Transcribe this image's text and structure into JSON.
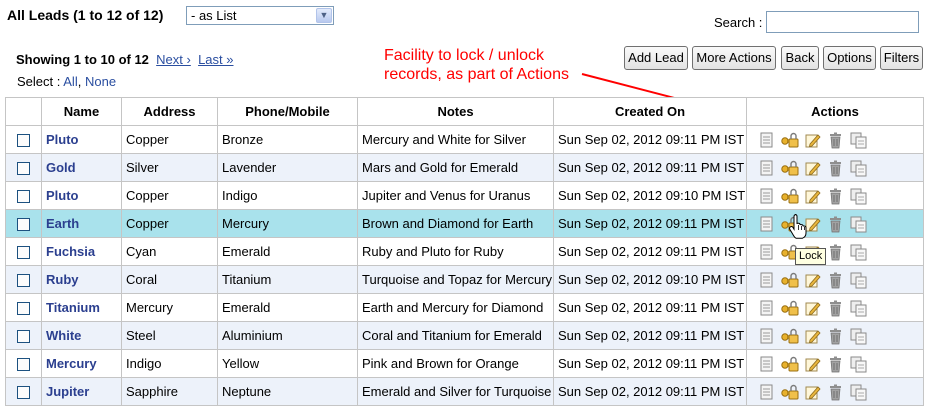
{
  "header": {
    "title": "All Leads (1 to 12 of 12)",
    "view_select": "- as List",
    "search_label": "Search :",
    "search_value": ""
  },
  "pager": {
    "showing": "Showing 1 to 10 of 12",
    "next": "Next ›",
    "last": "Last »",
    "select_label": "Select :",
    "select_all": "All",
    "select_sep": ",",
    "select_none": "None"
  },
  "toolbar": {
    "add_lead": "Add Lead",
    "more_actions": "More Actions",
    "back": "Back",
    "options": "Options",
    "filters": "Filters"
  },
  "annotation": {
    "line1": "Facility to lock / unlock",
    "line2": "records, as part of Actions",
    "color": "#ff0000"
  },
  "table": {
    "columns": [
      "Name",
      "Address",
      "Phone/Mobile",
      "Notes",
      "Created On",
      "Actions"
    ],
    "rows": [
      {
        "name": "Pluto",
        "address": "Copper",
        "phone": "Bronze",
        "notes": "Mercury and White for Silver",
        "created": "Sun Sep 02, 2012 09:11 PM IST"
      },
      {
        "name": "Gold",
        "address": "Silver",
        "phone": "Lavender",
        "notes": "Mars and Gold for Emerald",
        "created": "Sun Sep 02, 2012 09:11 PM IST"
      },
      {
        "name": "Pluto",
        "address": "Copper",
        "phone": "Indigo",
        "notes": "Jupiter and Venus for Uranus",
        "created": "Sun Sep 02, 2012 09:10 PM IST"
      },
      {
        "name": "Earth",
        "address": "Copper",
        "phone": "Mercury",
        "notes": "Brown and Diamond for Earth",
        "created": "Sun Sep 02, 2012 09:11 PM IST"
      },
      {
        "name": "Fuchsia",
        "address": "Cyan",
        "phone": "Emerald",
        "notes": "Ruby and Pluto for Ruby",
        "created": "Sun Sep 02, 2012 09:11 PM IST"
      },
      {
        "name": "Ruby",
        "address": "Coral",
        "phone": "Titanium",
        "notes": "Turquoise and Topaz for Mercury",
        "created": "Sun Sep 02, 2012 09:10 PM IST"
      },
      {
        "name": "Titanium",
        "address": "Mercury",
        "phone": "Emerald",
        "notes": "Earth and Mercury for Diamond",
        "created": "Sun Sep 02, 2012 09:11 PM IST"
      },
      {
        "name": "White",
        "address": "Steel",
        "phone": "Aluminium",
        "notes": "Coral and Titanium for Emerald",
        "created": "Sun Sep 02, 2012 09:11 PM IST"
      },
      {
        "name": "Mercury",
        "address": "Indigo",
        "phone": "Yellow",
        "notes": "Pink and Brown for Orange",
        "created": "Sun Sep 02, 2012 09:11 PM IST"
      },
      {
        "name": "Jupiter",
        "address": "Sapphire",
        "phone": "Neptune",
        "notes": "Emerald and Silver for Turquoise",
        "created": "Sun Sep 02, 2012 09:11 PM IST"
      }
    ],
    "highlighted_row": 3,
    "action_icons": [
      "view-icon",
      "lock-icon",
      "edit-icon",
      "delete-icon",
      "copy-icon"
    ]
  },
  "tooltip": "Lock",
  "colors": {
    "link": "#2a4ea0",
    "name": "#2b3f8f",
    "row_alt": "#edf2fa",
    "row_highlight": "#a9e2ec"
  }
}
